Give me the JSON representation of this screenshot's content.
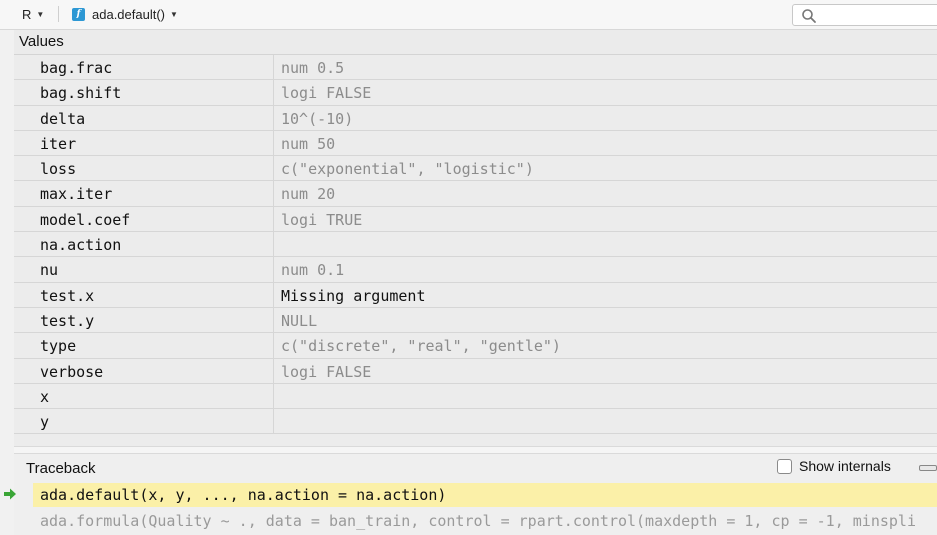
{
  "toolbar": {
    "language": "R",
    "function_name": "ada.default()",
    "search": {
      "placeholder": "",
      "value": ""
    }
  },
  "values": {
    "header": "Values",
    "rows": [
      {
        "name": "bag.frac",
        "value": "num 0.5",
        "style": "muted"
      },
      {
        "name": "bag.shift",
        "value": "logi FALSE",
        "style": "muted"
      },
      {
        "name": "delta",
        "value": "10^(-10)",
        "style": "muted"
      },
      {
        "name": "iter",
        "value": "num 50",
        "style": "muted"
      },
      {
        "name": "loss",
        "value": "c(\"exponential\", \"logistic\")",
        "style": "muted"
      },
      {
        "name": "max.iter",
        "value": "num 20",
        "style": "muted"
      },
      {
        "name": "model.coef",
        "value": "logi TRUE",
        "style": "muted"
      },
      {
        "name": "na.action",
        "value": "",
        "style": "muted"
      },
      {
        "name": "nu",
        "value": "num 0.1",
        "style": "muted"
      },
      {
        "name": "test.x",
        "value": "Missing argument",
        "style": "dark"
      },
      {
        "name": "test.y",
        "value": "NULL",
        "style": "muted"
      },
      {
        "name": "type",
        "value": "c(\"discrete\", \"real\", \"gentle\")",
        "style": "muted"
      },
      {
        "name": "verbose",
        "value": "logi FALSE",
        "style": "muted"
      },
      {
        "name": "x",
        "value": "",
        "style": "muted"
      },
      {
        "name": "y",
        "value": "",
        "style": "muted"
      }
    ]
  },
  "traceback": {
    "title": "Traceback",
    "show_internals_label": "Show internals",
    "show_internals_checked": false,
    "frames": [
      {
        "text": "ada.default(x, y, ..., na.action = na.action)",
        "active": true
      },
      {
        "text": "ada.formula(Quality ~ ., data = ban_train, control = rpart.control(maxdepth = 1, cp = -1, minspli",
        "active": false
      }
    ]
  },
  "colors": {
    "current_frame_highlight": "#fbf0a8",
    "current_frame_arrow": "#3aa536",
    "function_icon": "#2d98d4"
  }
}
